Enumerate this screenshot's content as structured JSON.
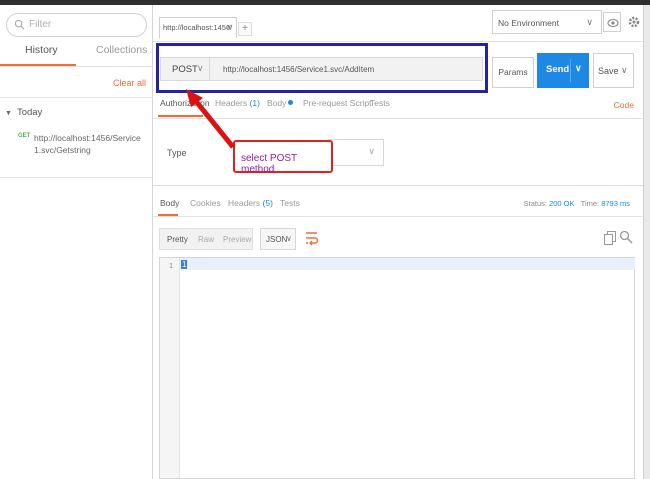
{
  "sidebar": {
    "filter_placeholder": "Filter",
    "tabs": [
      {
        "label": "History"
      },
      {
        "label": "Collections"
      }
    ],
    "clear_all": "Clear all",
    "group_label": "Today",
    "history_items": [
      {
        "method": "GET",
        "url": "http://localhost:1456/Service1.svc/Getstring"
      }
    ]
  },
  "tabbar": {
    "tab_label": "http://localhost:1456/",
    "close": "×",
    "new_tab": "+"
  },
  "environment": {
    "selected": "No Environment",
    "icons": {
      "eye": "eye-icon",
      "gear": "gear-icon"
    }
  },
  "request": {
    "method": "POST",
    "url": "http://localhost:1456/Service1.svc/AddItem",
    "params_label": "Params",
    "send_label": "Send",
    "save_label": "Save",
    "tabs": [
      {
        "label": "Authorization"
      },
      {
        "label": "Headers",
        "count": "(1)"
      },
      {
        "label": "Body"
      },
      {
        "label": "Pre-request Script"
      },
      {
        "label": "Tests"
      }
    ],
    "code_link": "Code",
    "type_label": "Type"
  },
  "annotation": {
    "callout_text": "select POST method",
    "colors": {
      "arrow": "#dd1111",
      "text": "#9b1a9b",
      "highlight_box": "#2323a3"
    }
  },
  "response": {
    "tabs": [
      {
        "label": "Body"
      },
      {
        "label": "Cookies"
      },
      {
        "label": "Headers",
        "count": "(5)"
      },
      {
        "label": "Tests"
      }
    ],
    "status_label": "Status:",
    "status_value": "200 OK",
    "time_label": "Time:",
    "time_value": "8793 ms",
    "view_modes": [
      {
        "label": "Pretty"
      },
      {
        "label": "Raw"
      },
      {
        "label": "Preview"
      }
    ],
    "format": "JSON",
    "line_number": "1",
    "body_text": "1"
  },
  "colors": {
    "accent": "#f26b3a",
    "send": "#1e88e5",
    "get_method": "#4fae4f"
  }
}
